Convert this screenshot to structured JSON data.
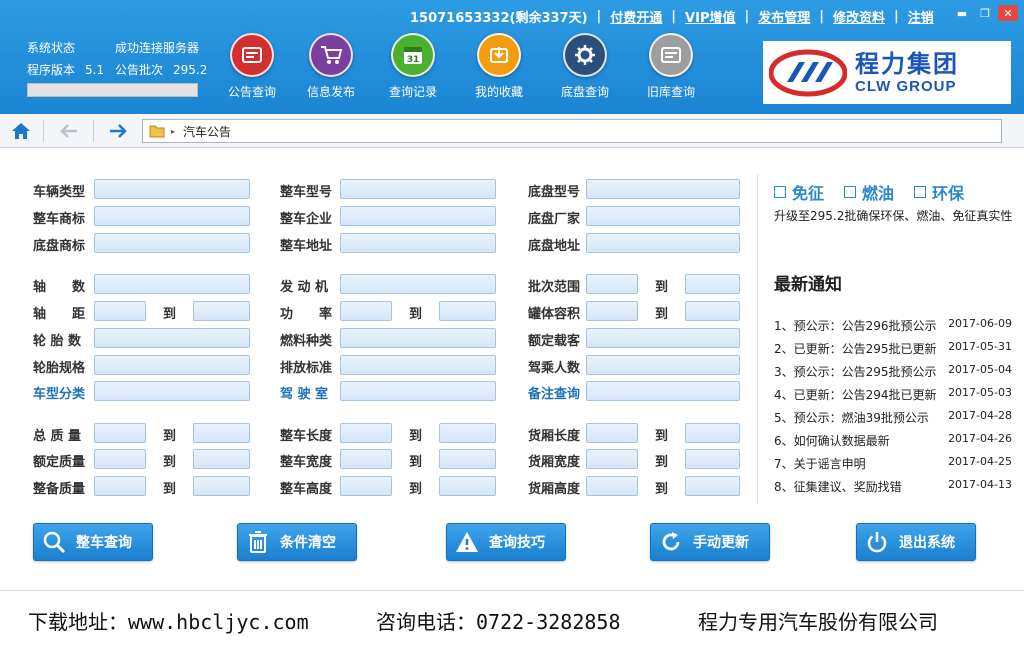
{
  "topbar": {
    "account": "15071653332(剩余337天)",
    "links": [
      "付费开通",
      "VIP增值",
      "发布管理",
      "修改资料",
      "注销"
    ]
  },
  "window_controls": {
    "minimize": "▬",
    "maximize": "❐",
    "close": "✕"
  },
  "sysinfo": {
    "status_label": "系统状态",
    "status_value": "成功连接服务器",
    "version_label": "程序版本",
    "version_value": "5.1",
    "batch_label": "公告批次",
    "batch_value": "295.2"
  },
  "nav_icons": [
    {
      "label": "公告查询",
      "icon": "notice-icon",
      "color": "#d32f2f"
    },
    {
      "label": "信息发布",
      "icon": "cart-icon",
      "color": "#7b3fa0"
    },
    {
      "label": "查询记录",
      "icon": "calendar-icon",
      "color": "#4caf2f",
      "badge": "31"
    },
    {
      "label": "我的收藏",
      "icon": "favorites-icon",
      "color": "#f39c12"
    },
    {
      "label": "底盘查询",
      "icon": "gear-icon",
      "color": "#2a4f7a"
    },
    {
      "label": "旧库查询",
      "icon": "archive-icon",
      "color": "#9e9e9e"
    }
  ],
  "logo": {
    "cn": "程力集团",
    "en": "CLW GROUP"
  },
  "address": {
    "path": "汽车公告"
  },
  "form": {
    "col1": [
      "车辆类型",
      "整车商标",
      "底盘商标",
      "轴　　数",
      "轴　　距",
      "轮 胎 数",
      "轮胎规格",
      "车型分类",
      "总 质 量",
      "额定质量",
      "整备质量"
    ],
    "col2": [
      "整车型号",
      "整车企业",
      "整车地址",
      "发 动 机",
      "功　　率",
      "燃料种类",
      "排放标准",
      "驾 驶 室",
      "整车长度",
      "整车宽度",
      "整车高度"
    ],
    "col3": [
      "底盘型号",
      "底盘厂家",
      "底盘地址",
      "批次范围",
      "罐体容积",
      "额定载客",
      "驾乘人数",
      "备注查询",
      "货厢长度",
      "货厢宽度",
      "货厢高度"
    ],
    "to_label": "到"
  },
  "right_panel": {
    "checkboxes": [
      "免征",
      "燃油",
      "环保"
    ],
    "upgrade_text": "升级至295.2批确保环保、燃油、免征真实性",
    "news_title": "最新通知",
    "news": [
      {
        "text": "1、预公示：公告296批预公示",
        "date": "2017-06-09"
      },
      {
        "text": "2、已更新：公告295批已更新",
        "date": "2017-05-31"
      },
      {
        "text": "3、预公示：公告295批预公示",
        "date": "2017-05-04"
      },
      {
        "text": "4、已更新：公告294批已更新",
        "date": "2017-05-03"
      },
      {
        "text": "5、预公示：燃油39批预公示",
        "date": "2017-04-28"
      },
      {
        "text": "6、如何确认数据最新",
        "date": "2017-04-26"
      },
      {
        "text": "7、关于谣言申明",
        "date": "2017-04-25"
      },
      {
        "text": "8、征集建议、奖励找错",
        "date": "2017-04-13"
      }
    ]
  },
  "actions": [
    "整车查询",
    "条件清空",
    "查询技巧",
    "手动更新",
    "退出系统"
  ],
  "footer": {
    "download": "下载地址：www.hbcljyc.com",
    "phone": "咨询电话：0722-3282858",
    "company": "程力专用汽车股份有限公司"
  }
}
